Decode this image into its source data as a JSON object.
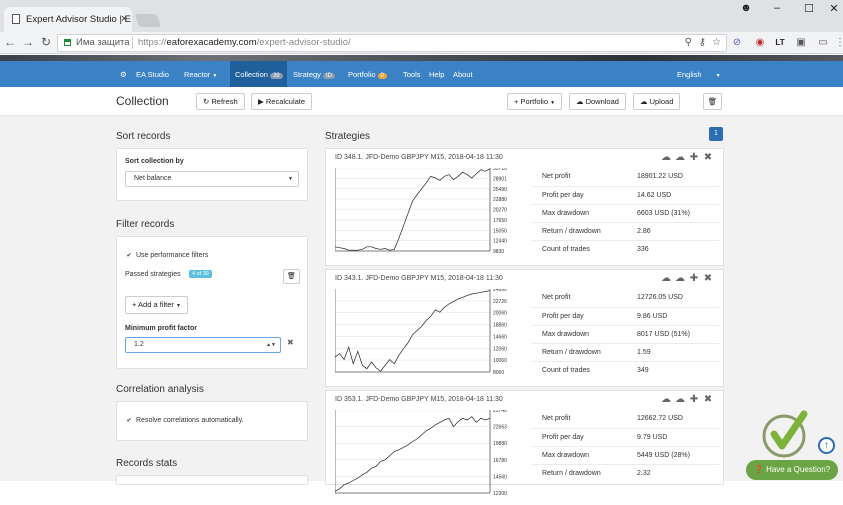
{
  "browser": {
    "tab_title": "Expert Advisor Studio | E",
    "tab_close": "×",
    "security_label": "Има защита",
    "url_scheme": "https://",
    "url_host": "eaforexacademy.com",
    "url_path": "/expert-advisor-studio/",
    "ext_lt": "LT"
  },
  "nav": {
    "items": [
      {
        "label": "EA Studio"
      },
      {
        "label": "Reactor"
      },
      {
        "label": "Collection",
        "badge": "39"
      },
      {
        "label": "Strategy",
        "badge": "ID"
      },
      {
        "label": "Portfolio",
        "badge": "0"
      },
      {
        "label": "Tools"
      },
      {
        "label": "Help"
      },
      {
        "label": "About"
      }
    ],
    "language": "English"
  },
  "toolbar": {
    "title": "Collection",
    "refresh": "Refresh",
    "recalculate": "Recalculate",
    "portfolio": "Portfolio",
    "download": "Download",
    "upload": "Upload"
  },
  "sidebar": {
    "sort_heading": "Sort records",
    "sort_label": "Sort collection by",
    "sort_value": "Net balance",
    "filter_heading": "Filter records",
    "use_filters": "Use performance filters",
    "passed_label": "Passed strategies",
    "passed_badge": "4 of 39",
    "add_filter": "+ Add a filter",
    "min_pf_label": "Minimum profit factor",
    "min_pf_value": "1.2",
    "corr_heading": "Correlation analysis",
    "resolve_corr": "Resolve correlations automatically.",
    "stats_heading": "Records stats"
  },
  "main": {
    "heading": "Strategies",
    "page": "1"
  },
  "strategies": [
    {
      "title": "ID 348.1. JFD-Demo GBPJPY M15, 2018-04-18 11:30",
      "ticks": [
        "33710",
        "28901",
        "25490",
        "22880",
        "20270",
        "17650",
        "15050",
        "12440",
        "9830"
      ],
      "stats": [
        {
          "k": "Net profit",
          "v": "18901.22 USD"
        },
        {
          "k": "Profit per day",
          "v": "14.62 USD"
        },
        {
          "k": "Max drawdown",
          "v": "6603 USD (31%)"
        },
        {
          "k": "Return / drawdown",
          "v": "2.86"
        },
        {
          "k": "Count of trades",
          "v": "336"
        }
      ]
    },
    {
      "title": "ID 343.1. JFD-Demo GBPJPY M15, 2018-04-18 11:30",
      "ticks": [
        "24860",
        "22726",
        "20060",
        "18860",
        "14660",
        "12060",
        "10060",
        "8060"
      ],
      "stats": [
        {
          "k": "Net profit",
          "v": "12726.05 USD"
        },
        {
          "k": "Profit per day",
          "v": "9.86 USD"
        },
        {
          "k": "Max drawdown",
          "v": "8017 USD (51%)"
        },
        {
          "k": "Return / drawdown",
          "v": "1.59"
        },
        {
          "k": "Count of trades",
          "v": "349"
        }
      ]
    },
    {
      "title": "ID 353.1. JFD-Demo GBPJPY M15, 2018-04-18 11:30",
      "ticks": [
        "25740",
        "22663",
        "19880",
        "16780",
        "14560",
        "12300"
      ],
      "stats": [
        {
          "k": "Net profit",
          "v": "12662.72 USD"
        },
        {
          "k": "Profit per day",
          "v": "9.79 USD"
        },
        {
          "k": "Max drawdown",
          "v": "5449 USD (28%)"
        },
        {
          "k": "Return / drawdown",
          "v": "2.32"
        }
      ]
    }
  ],
  "help_button": "Have a Question?"
}
